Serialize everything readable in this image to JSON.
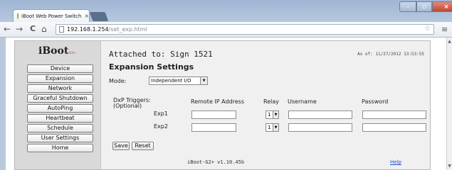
{
  "browser": {
    "tab_title": "iBoot Web Power Switch",
    "tab_close": "×",
    "url_host": "192.168.1.254",
    "url_path": "/set_exp.html",
    "back_icon": "←",
    "forward_icon": "→",
    "reload_icon": "C",
    "home_icon": "⌂",
    "star_icon": "☆",
    "menu_icon": "≡",
    "min_icon": "–",
    "max_icon": "▫",
    "close_icon": "×"
  },
  "logo": {
    "text": "iBoot",
    "sup": "G2+"
  },
  "sidebar": {
    "items": [
      {
        "label": "Device"
      },
      {
        "label": "Expansion"
      },
      {
        "label": "Network"
      },
      {
        "label": "Graceful Shutdown"
      },
      {
        "label": "AutoPing"
      },
      {
        "label": "Heartbeat"
      },
      {
        "label": "Schedule"
      },
      {
        "label": "User Settings"
      },
      {
        "label": "Home"
      }
    ]
  },
  "header": {
    "attached": "Attached to: Sign 1521",
    "as_of": "As of: 11/27/2012 13:53:55"
  },
  "main": {
    "title": "Expansion Settings",
    "mode_label": "Mode:",
    "mode_value": "Independent I/O",
    "dxp_label": "DxP Triggers:",
    "dxp_optional": "(Optional)",
    "col_ip": "Remote IP Address",
    "col_relay": "Relay",
    "col_user": "Username",
    "col_pass": "Password",
    "rows": [
      {
        "label": "Exp1",
        "relay": "1"
      },
      {
        "label": "Exp2",
        "relay": "1"
      }
    ],
    "save_label": "Save",
    "reset_label": "Reset"
  },
  "footer": {
    "version": "iBoot-G2+ v1.10.45b",
    "help": "Help"
  }
}
